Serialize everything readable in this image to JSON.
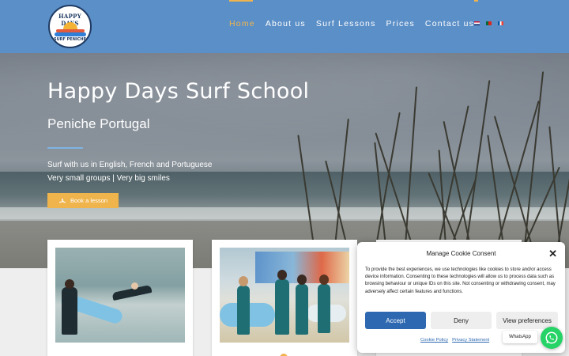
{
  "header": {
    "logo": {
      "top_text": "HAPPY DAYS",
      "bottom_text": "SURF PENICHE"
    },
    "nav": [
      {
        "label": "Home",
        "active": true
      },
      {
        "label": "About us",
        "active": false
      },
      {
        "label": "Surf Lessons",
        "active": false
      },
      {
        "label": "Prices",
        "active": false
      },
      {
        "label": "Contact us",
        "active": false
      }
    ],
    "languages": [
      "English",
      "Português",
      "Français"
    ],
    "colors": {
      "bar": "#5b8fc7",
      "accent": "#f0b44c"
    }
  },
  "hero": {
    "title": "Happy Days Surf School",
    "subtitle": "Peniche Portugal",
    "line1": "Surf with us in English, French and Portuguese",
    "line2": "Very small groups | Very big smiles",
    "cta_label": "Book a lesson",
    "cta_icon": "surfer-icon"
  },
  "cookie": {
    "title": "Manage Cookie Consent",
    "body": "To provide the best experiences, we use technologies like cookies to store and/or access device information. Consenting to these technologies will allow us to process data such as browsing behaviour or unique IDs on this site. Not consenting or withdrawing consent, may adversely affect certain features and functions.",
    "accept": "Accept",
    "deny": "Deny",
    "preferences": "View preferences",
    "cookie_policy": "Cookie Policy",
    "privacy_statement": "Privacy Statement",
    "accent": "#2d68b1"
  },
  "whatsapp": {
    "label": "WhatsApp",
    "icon": "whatsapp-icon",
    "color": "#25d366"
  }
}
